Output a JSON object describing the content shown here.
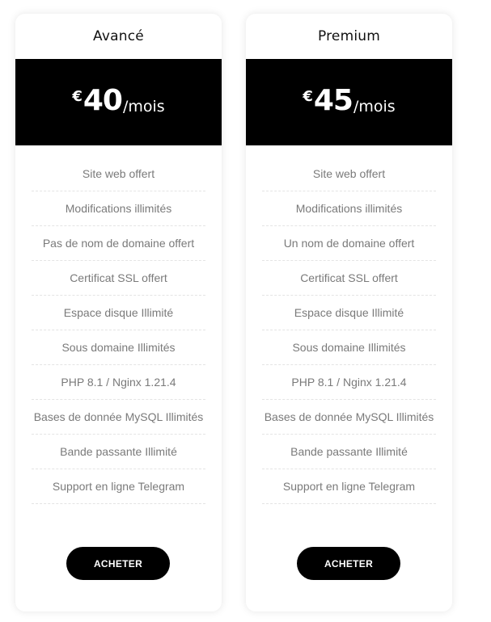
{
  "plans": [
    {
      "name": "Avancé",
      "currency": "€",
      "amount": "40",
      "period": "/mois",
      "features": [
        "Site web offert",
        "Modifications illimités",
        "Pas de nom de domaine offert",
        "Certificat SSL offert",
        "Espace disque Illimité",
        "Sous domaine Illimités",
        "PHP 8.1 / Nginx 1.21.4",
        "Bases de donnée MySQL Illimités",
        "Bande passante Illimité",
        "Support en ligne Telegram"
      ],
      "button_label": "ACHETER"
    },
    {
      "name": "Premium",
      "currency": "€",
      "amount": "45",
      "period": "/mois",
      "features": [
        "Site web offert",
        "Modifications illimités",
        "Un nom de domaine offert",
        "Certificat SSL offert",
        "Espace disque Illimité",
        "Sous domaine Illimités",
        "PHP 8.1 / Nginx 1.21.4",
        "Bases de donnée MySQL Illimités",
        "Bande passante Illimité",
        "Support en ligne Telegram"
      ],
      "button_label": "ACHETER"
    }
  ],
  "colors": {
    "price_band": "#000000",
    "button": "#000000",
    "feature_text": "#7a7a7a"
  }
}
